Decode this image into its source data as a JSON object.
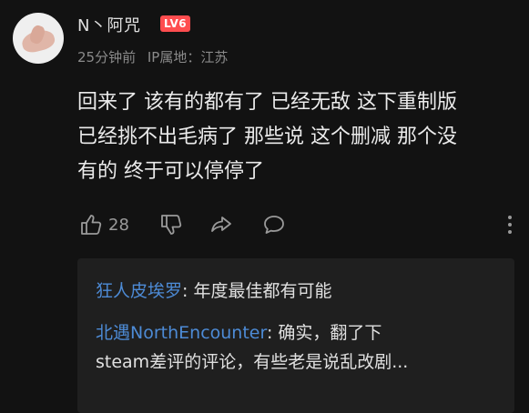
{
  "comment": {
    "username": "N丶阿咒",
    "level_badge": "LV6",
    "time": "25分钟前",
    "ip_location": "IP属地：江苏",
    "text_lines": [
      "回来了 该有的都有了 已经无敌 这下重制版",
      "已经挑不出毛病了 那些说 这个删减 那个没",
      "有的 终于可以停停了"
    ],
    "like_count": "28"
  },
  "replies": [
    {
      "author": "狂人皮埃罗",
      "text": ": 年度最佳都有可能"
    },
    {
      "author": "北遇NorthEncounter",
      "text": ": 确实，翻了下",
      "text2": "steam差评的评论，有些老是说乱改剧..."
    }
  ],
  "icons": {
    "like": "thumb-up-icon",
    "dislike": "thumb-down-icon",
    "share": "share-icon",
    "comment": "comment-icon",
    "more": "more-vertical-icon"
  },
  "colors": {
    "background": "#121212",
    "level_badge": "#ff4d4f",
    "reply_author": "#4d8bd6",
    "reply_bg": "#1f1f1f"
  }
}
